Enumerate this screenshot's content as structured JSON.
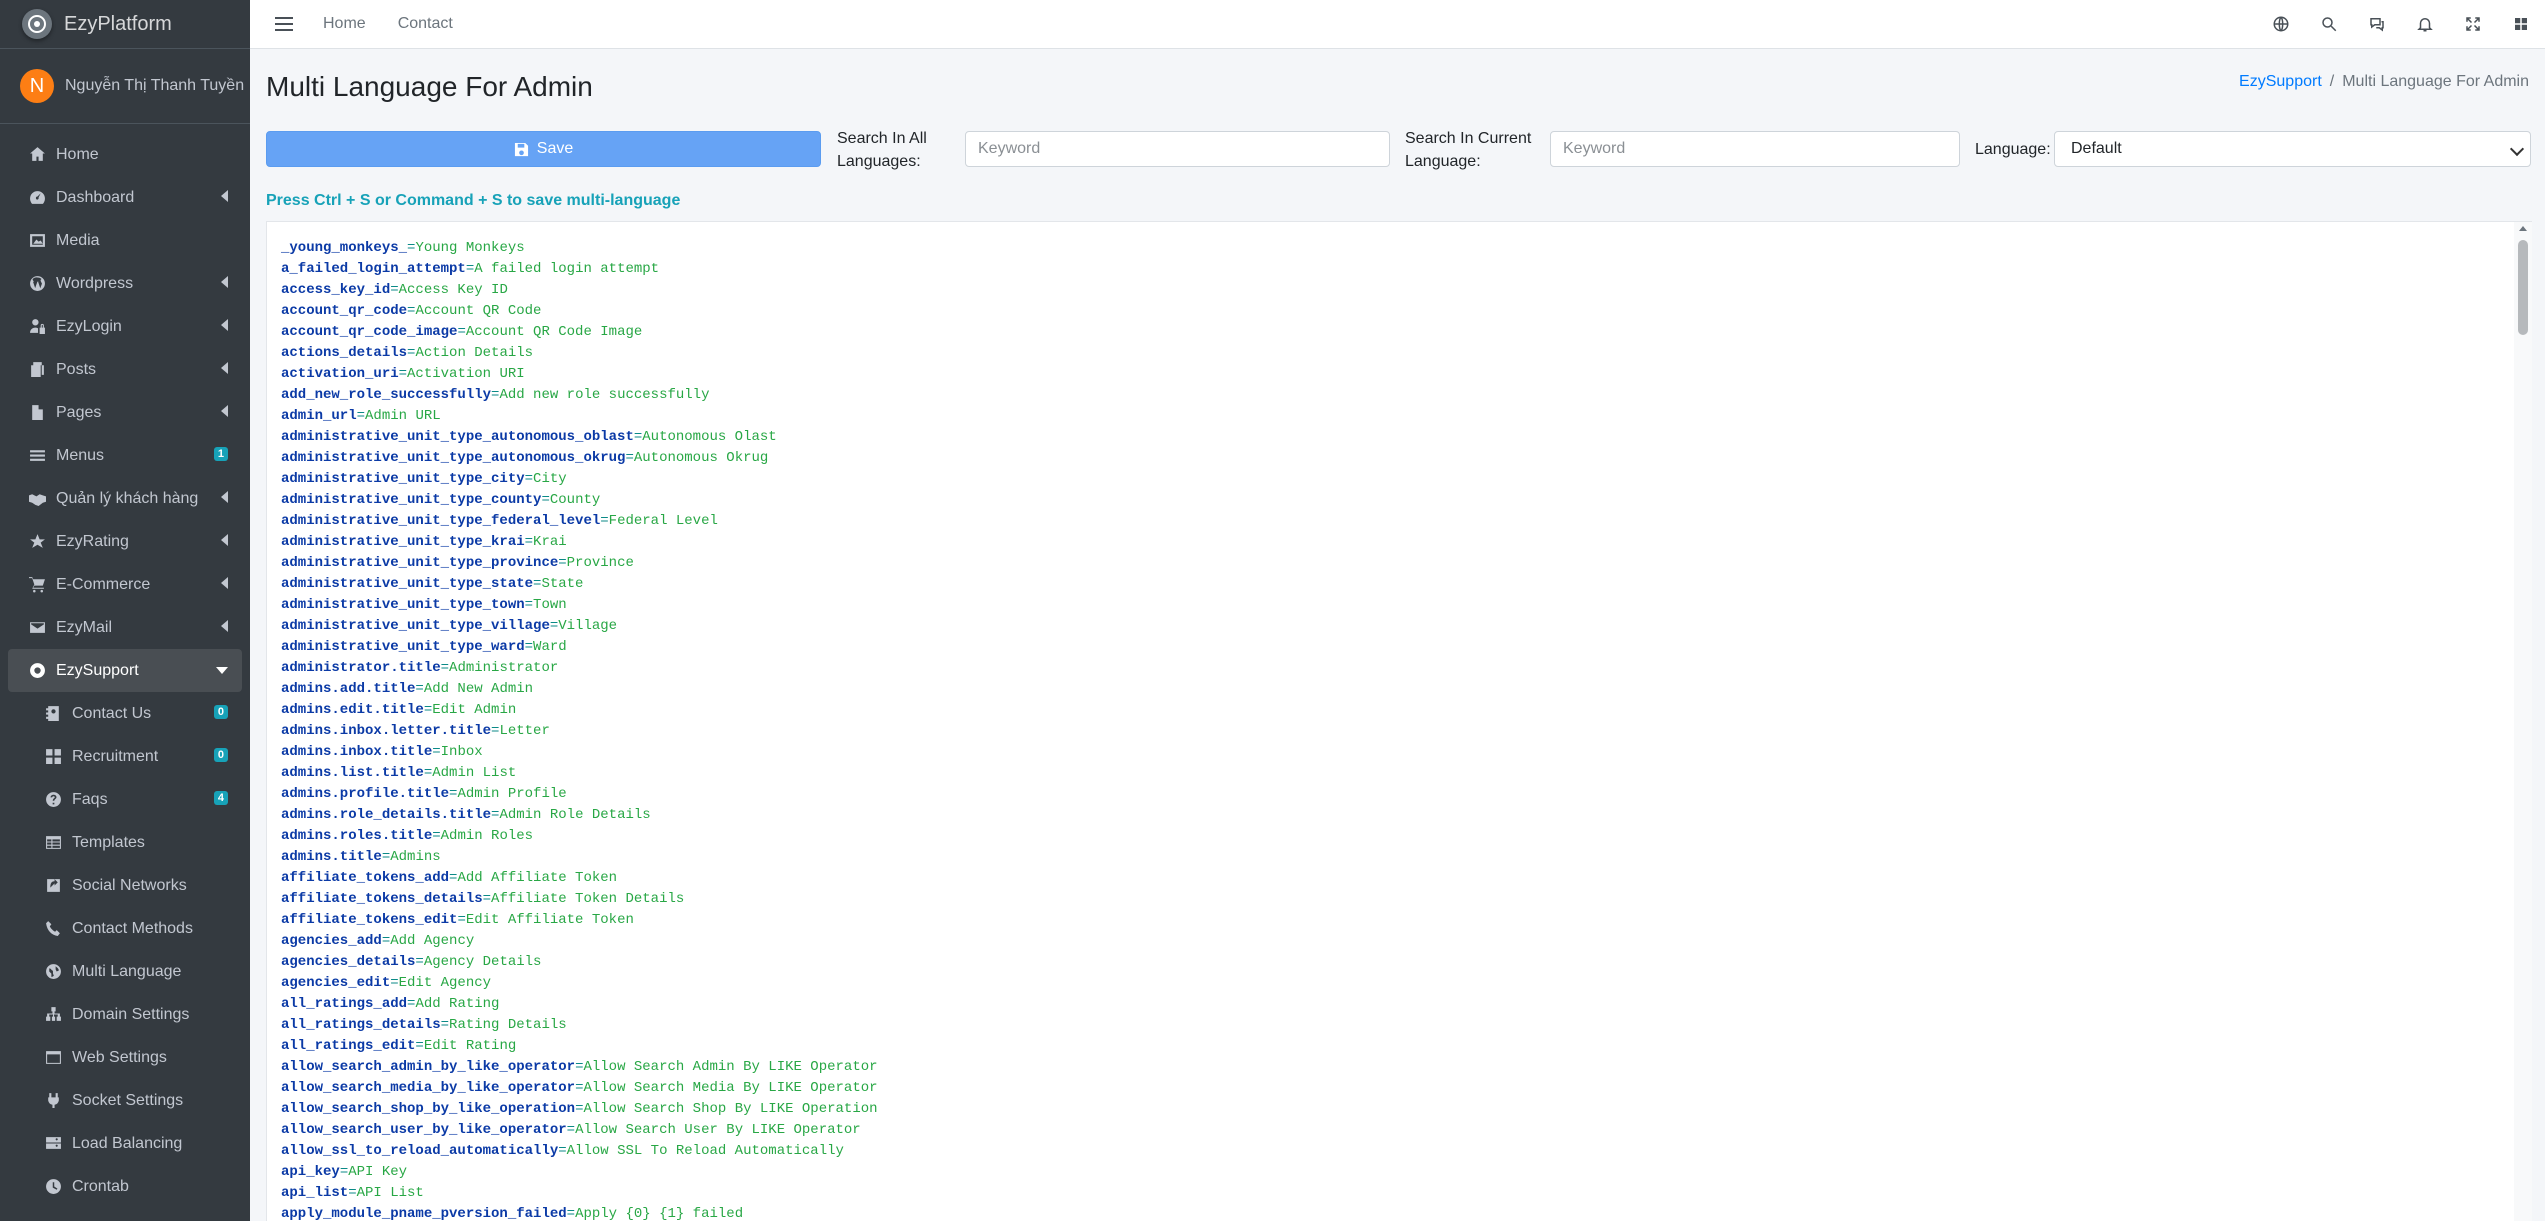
{
  "brand": {
    "name": "EzyPlatform"
  },
  "user": {
    "initial": "N",
    "name": "Nguyễn Thị Thanh Tuyền"
  },
  "sidebar": {
    "items": [
      {
        "label": "Home",
        "icon": "home-icon"
      },
      {
        "label": "Dashboard",
        "icon": "tachometer-icon",
        "caret": true
      },
      {
        "label": "Media",
        "icon": "image-icon"
      },
      {
        "label": "Wordpress",
        "icon": "wordpress-icon",
        "caret": true
      },
      {
        "label": "EzyLogin",
        "icon": "user-lock-icon",
        "caret": true
      },
      {
        "label": "Posts",
        "icon": "copy-icon",
        "caret": true
      },
      {
        "label": "Pages",
        "icon": "file-icon",
        "caret": true
      },
      {
        "label": "Menus",
        "icon": "bars-icon",
        "badge": "1"
      },
      {
        "label": "Quản lý khách hàng",
        "icon": "handshake-icon",
        "caret": true
      },
      {
        "label": "EzyRating",
        "icon": "star-icon",
        "caret": true
      },
      {
        "label": "E-Commerce",
        "icon": "shopping-cart-icon",
        "caret": true
      },
      {
        "label": "EzyMail",
        "icon": "envelope-icon",
        "caret": true
      },
      {
        "label": "EzySupport",
        "icon": "life-ring-icon",
        "expanded": true
      }
    ],
    "sub_items": [
      {
        "label": "Contact Us",
        "icon": "address-book-icon",
        "badge": "0"
      },
      {
        "label": "Recruitment",
        "icon": "th-large-icon",
        "badge": "0"
      },
      {
        "label": "Faqs",
        "icon": "question-circle-icon",
        "badge": "4"
      },
      {
        "label": "Templates",
        "icon": "table-icon"
      },
      {
        "label": "Social Networks",
        "icon": "share-square-icon"
      },
      {
        "label": "Contact Methods",
        "icon": "phone-icon"
      },
      {
        "label": "Multi Language",
        "icon": "globe-icon"
      },
      {
        "label": "Domain Settings",
        "icon": "sitemap-icon"
      },
      {
        "label": "Web Settings",
        "icon": "window-icon"
      },
      {
        "label": "Socket Settings",
        "icon": "plug-icon"
      },
      {
        "label": "Load Balancing",
        "icon": "server-icon"
      },
      {
        "label": "Crontab",
        "icon": "clock-icon"
      }
    ]
  },
  "topbar": {
    "home": "Home",
    "contact": "Contact"
  },
  "page": {
    "title": "Multi Language For Admin",
    "breadcrumb_parent": "EzySupport",
    "breadcrumb_current": "Multi Language For Admin",
    "save_label": "Save",
    "search_all_label_1": "Search In All",
    "search_all_label_2": "Languages:",
    "search_current_label_1": "Search In Current",
    "search_current_label_2": "Language:",
    "keyword_placeholder": "Keyword",
    "language_label": "Language:",
    "language_value": "Default",
    "hint": "Press Ctrl + S or Command + S to save multi-language"
  },
  "entries": [
    {
      "k": "_young_monkeys_",
      "v": "Young Monkeys"
    },
    {
      "k": "a_failed_login_attempt",
      "v": "A failed login attempt"
    },
    {
      "k": "access_key_id",
      "v": "Access Key ID"
    },
    {
      "k": "account_qr_code",
      "v": "Account QR Code"
    },
    {
      "k": "account_qr_code_image",
      "v": "Account QR Code Image"
    },
    {
      "k": "actions_details",
      "v": "Action Details"
    },
    {
      "k": "activation_uri",
      "v": "Activation URI"
    },
    {
      "k": "add_new_role_successfully",
      "v": "Add new role successfully"
    },
    {
      "k": "admin_url",
      "v": "Admin URL"
    },
    {
      "k": "administrative_unit_type_autonomous_oblast",
      "v": "Autonomous Olast"
    },
    {
      "k": "administrative_unit_type_autonomous_okrug",
      "v": "Autonomous Okrug"
    },
    {
      "k": "administrative_unit_type_city",
      "v": "City"
    },
    {
      "k": "administrative_unit_type_county",
      "v": "County"
    },
    {
      "k": "administrative_unit_type_federal_level",
      "v": "Federal Level"
    },
    {
      "k": "administrative_unit_type_krai",
      "v": "Krai"
    },
    {
      "k": "administrative_unit_type_province",
      "v": "Province"
    },
    {
      "k": "administrative_unit_type_state",
      "v": "State"
    },
    {
      "k": "administrative_unit_type_town",
      "v": "Town"
    },
    {
      "k": "administrative_unit_type_village",
      "v": "Village"
    },
    {
      "k": "administrative_unit_type_ward",
      "v": "Ward"
    },
    {
      "k": "administrator.title",
      "v": "Administrator"
    },
    {
      "k": "admins.add.title",
      "v": "Add New Admin"
    },
    {
      "k": "admins.edit.title",
      "v": "Edit Admin"
    },
    {
      "k": "admins.inbox.letter.title",
      "v": "Letter"
    },
    {
      "k": "admins.inbox.title",
      "v": "Inbox"
    },
    {
      "k": "admins.list.title",
      "v": "Admin List"
    },
    {
      "k": "admins.profile.title",
      "v": "Admin Profile"
    },
    {
      "k": "admins.role_details.title",
      "v": "Admin Role Details"
    },
    {
      "k": "admins.roles.title",
      "v": "Admin Roles"
    },
    {
      "k": "admins.title",
      "v": "Admins"
    },
    {
      "k": "affiliate_tokens_add",
      "v": "Add Affiliate Token"
    },
    {
      "k": "affiliate_tokens_details",
      "v": "Affiliate Token Details"
    },
    {
      "k": "affiliate_tokens_edit",
      "v": "Edit Affiliate Token"
    },
    {
      "k": "agencies_add",
      "v": "Add Agency"
    },
    {
      "k": "agencies_details",
      "v": "Agency Details"
    },
    {
      "k": "agencies_edit",
      "v": "Edit Agency"
    },
    {
      "k": "all_ratings_add",
      "v": "Add Rating"
    },
    {
      "k": "all_ratings_details",
      "v": "Rating Details"
    },
    {
      "k": "all_ratings_edit",
      "v": "Edit Rating"
    },
    {
      "k": "allow_search_admin_by_like_operator",
      "v": "Allow Search Admin By LIKE Operator"
    },
    {
      "k": "allow_search_media_by_like_operator",
      "v": "Allow Search Media By LIKE Operator"
    },
    {
      "k": "allow_search_shop_by_like_operation",
      "v": "Allow Search Shop By LIKE Operation"
    },
    {
      "k": "allow_search_user_by_like_operator",
      "v": "Allow Search User By LIKE Operator"
    },
    {
      "k": "allow_ssl_to_reload_automatically",
      "v": "Allow SSL To Reload Automatically"
    },
    {
      "k": "api_key",
      "v": "API Key"
    },
    {
      "k": "api_list",
      "v": "API List"
    },
    {
      "k": "apply_module_pname_pversion_failed",
      "v": "Apply {0} {1} failed"
    }
  ]
}
